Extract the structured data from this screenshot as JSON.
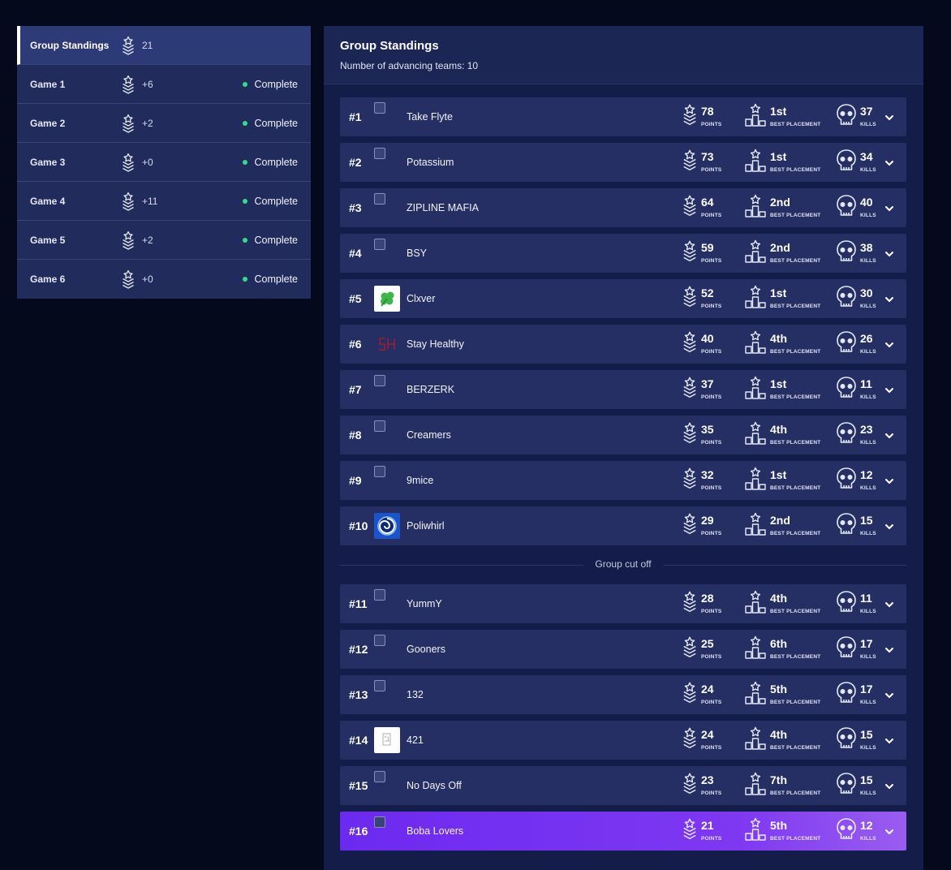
{
  "sidebar": {
    "items": [
      {
        "label": "Group Standings",
        "points": "21",
        "status": "",
        "active": true
      },
      {
        "label": "Game 1",
        "points": "+6",
        "status": "Complete"
      },
      {
        "label": "Game 2",
        "points": "+2",
        "status": "Complete"
      },
      {
        "label": "Game 3",
        "points": "+0",
        "status": "Complete"
      },
      {
        "label": "Game 4",
        "points": "+11",
        "status": "Complete"
      },
      {
        "label": "Game 5",
        "points": "+2",
        "status": "Complete"
      },
      {
        "label": "Game 6",
        "points": "+0",
        "status": "Complete"
      }
    ]
  },
  "panel": {
    "title": "Group Standings",
    "subtitle": "Number of advancing teams: 10",
    "cutoff_label": "Group cut off",
    "stat_captions": {
      "points": "POINTS",
      "placement": "BEST PLACEMENT",
      "kills": "KILLS"
    }
  },
  "colors": {
    "background": "#040a1c",
    "panel": "#141d49",
    "row": "#262f64",
    "highlight": "#7e38f2",
    "status_dot": "#2fe08a"
  },
  "standings": [
    {
      "rank": "#1",
      "team": "Take Flyte",
      "points": "78",
      "placement": "1st",
      "kills": "37",
      "logo": "broken"
    },
    {
      "rank": "#2",
      "team": "Potassium",
      "points": "73",
      "placement": "1st",
      "kills": "34",
      "logo": "broken"
    },
    {
      "rank": "#3",
      "team": "ZIPLINE MAFIA",
      "points": "64",
      "placement": "2nd",
      "kills": "40",
      "logo": "broken"
    },
    {
      "rank": "#4",
      "team": "BSY",
      "points": "59",
      "placement": "2nd",
      "kills": "38",
      "logo": "broken"
    },
    {
      "rank": "#5",
      "team": "Clxver",
      "points": "52",
      "placement": "1st",
      "kills": "30",
      "logo": "clover"
    },
    {
      "rank": "#6",
      "team": "Stay Healthy",
      "points": "40",
      "placement": "4th",
      "kills": "26",
      "logo": "sh"
    },
    {
      "rank": "#7",
      "team": "BERZERK",
      "points": "37",
      "placement": "1st",
      "kills": "11",
      "logo": "broken"
    },
    {
      "rank": "#8",
      "team": "Creamers",
      "points": "35",
      "placement": "4th",
      "kills": "23",
      "logo": "broken"
    },
    {
      "rank": "#9",
      "team": "9mice",
      "points": "32",
      "placement": "1st",
      "kills": "12",
      "logo": "broken"
    },
    {
      "rank": "#10",
      "team": "Poliwhirl",
      "points": "29",
      "placement": "2nd",
      "kills": "15",
      "logo": "poliwhirl"
    },
    {
      "rank": "#11",
      "team": "YummY",
      "points": "28",
      "placement": "4th",
      "kills": "11",
      "logo": "broken"
    },
    {
      "rank": "#12",
      "team": "Gooners",
      "points": "25",
      "placement": "6th",
      "kills": "17",
      "logo": "broken"
    },
    {
      "rank": "#13",
      "team": "132",
      "points": "24",
      "placement": "5th",
      "kills": "17",
      "logo": "broken"
    },
    {
      "rank": "#14",
      "team": "421",
      "points": "24",
      "placement": "4th",
      "kills": "15",
      "logo": "sketch"
    },
    {
      "rank": "#15",
      "team": "No Days Off",
      "points": "23",
      "placement": "7th",
      "kills": "15",
      "logo": "broken"
    },
    {
      "rank": "#16",
      "team": "Boba Lovers",
      "points": "21",
      "placement": "5th",
      "kills": "12",
      "logo": "broken",
      "highlight": true
    }
  ]
}
